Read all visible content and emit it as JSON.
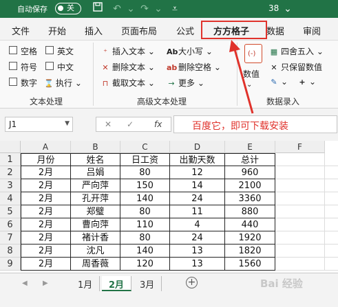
{
  "titlebar": {
    "autosave_label": "自动保存",
    "toggle_state": "关",
    "number": "38",
    "icons": [
      "save-icon",
      "undo-icon",
      "redo-icon",
      "dropdown-icon"
    ]
  },
  "tabs": [
    "文件",
    "开始",
    "插入",
    "页面布局",
    "公式",
    "方方格子",
    "数据",
    "审阅"
  ],
  "active_tab": "方方格子",
  "ribbon": {
    "checkboxes": [
      {
        "label": "空格"
      },
      {
        "label": "英文"
      },
      {
        "label": "符号"
      },
      {
        "label": "中文"
      },
      {
        "label": "数字"
      }
    ],
    "execute_label": "执行",
    "text_group_label": "文本处理",
    "advanced": {
      "insert_text": "插入文本",
      "delete_text": "删除文本",
      "extract_text": "截取文本",
      "case": "大小写",
      "delete_space": "删除空格",
      "more": "更多",
      "group_label": "高级文本处理"
    },
    "data": {
      "value_btn": "数值",
      "round": "四舍五入",
      "keep_value": "只保留数值",
      "group_label": "数据录入"
    }
  },
  "formula_bar": {
    "cell_ref": "J1",
    "fx": "fx",
    "annotation": "百度它，即可下载安装"
  },
  "sheet": {
    "columns": [
      "A",
      "B",
      "C",
      "D",
      "E",
      "F"
    ],
    "row_numbers": [
      "1",
      "2",
      "3",
      "4",
      "5",
      "6",
      "7",
      "8",
      "9"
    ],
    "rows": [
      [
        "月份",
        "姓名",
        "日工资",
        "出勤天数",
        "总计"
      ],
      [
        "2月",
        "吕娟",
        "80",
        "12",
        "960"
      ],
      [
        "2月",
        "严向萍",
        "150",
        "14",
        "2100"
      ],
      [
        "2月",
        "孔开萍",
        "140",
        "24",
        "3360"
      ],
      [
        "2月",
        "郑璧",
        "80",
        "11",
        "880"
      ],
      [
        "2月",
        "曹向萍",
        "110",
        "4",
        "440"
      ],
      [
        "2月",
        "褚计香",
        "80",
        "24",
        "1920"
      ],
      [
        "2月",
        "沈凡",
        "140",
        "13",
        "1820"
      ],
      [
        "2月",
        "周香薇",
        "120",
        "13",
        "1560"
      ]
    ]
  },
  "sheet_tabs": [
    "1月",
    "2月",
    "3月"
  ],
  "active_sheet": "2月",
  "add_sheet": "+",
  "watermark": "Bai 经验"
}
